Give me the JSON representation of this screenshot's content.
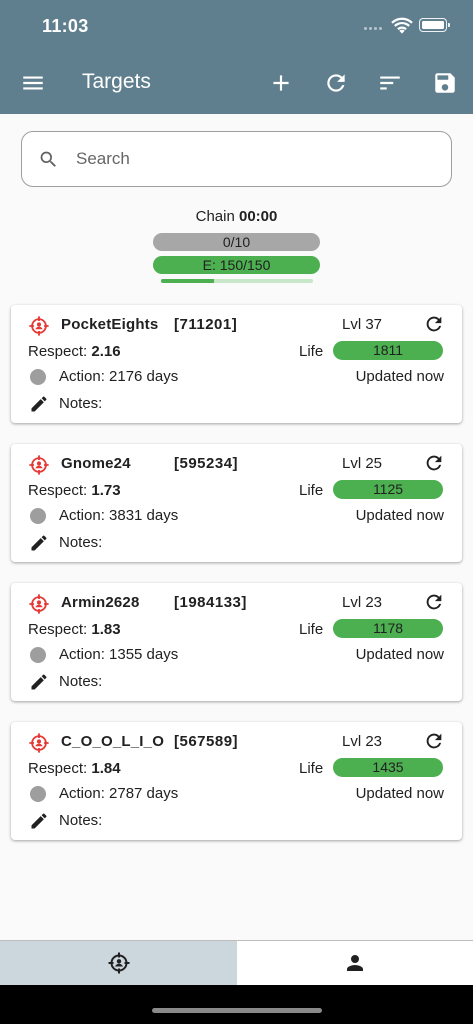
{
  "status_bar": {
    "time": "11:03"
  },
  "header": {
    "title": "Targets",
    "actions": [
      "menu-icon",
      "add-icon",
      "refresh-icon",
      "sort-icon",
      "save-icon"
    ]
  },
  "search": {
    "placeholder": "Search",
    "value": ""
  },
  "chain": {
    "label": "Chain",
    "timer": "00:00",
    "count_text": "0/10",
    "energy_text": "E: 150/150",
    "progress_fraction": 0.35
  },
  "colors": {
    "appbar": "#5f7f8e",
    "life_bar": "#4caf50",
    "target_icon": "#e53935",
    "active_tab": "#ccd6dd"
  },
  "targets": [
    {
      "name": "PocketEights",
      "id": "[711201]",
      "level": "Lvl 37",
      "respect_label": "Respect:",
      "respect": "2.16",
      "life_label": "Life",
      "life": "1811",
      "action": "Action: 2176 days",
      "updated": "Updated now",
      "notes": "Notes:"
    },
    {
      "name": "Gnome24",
      "id": "[595234]",
      "level": "Lvl 25",
      "respect_label": "Respect:",
      "respect": "1.73",
      "life_label": "Life",
      "life": "1125",
      "action": "Action: 3831 days",
      "updated": "Updated now",
      "notes": "Notes:"
    },
    {
      "name": "Armin2628",
      "id": "[1984133]",
      "level": "Lvl 23",
      "respect_label": "Respect:",
      "respect": "1.83",
      "life_label": "Life",
      "life": "1178",
      "action": "Action: 1355 days",
      "updated": "Updated now",
      "notes": "Notes:"
    },
    {
      "name": "C_O_O_L_I_O",
      "id": "[567589]",
      "level": "Lvl 23",
      "respect_label": "Respect:",
      "respect": "1.84",
      "life_label": "Life",
      "life": "1435",
      "action": "Action: 2787 days",
      "updated": "Updated now",
      "notes": "Notes:"
    }
  ],
  "bottom_nav": {
    "tabs": [
      "crosshair-icon",
      "person-icon"
    ],
    "active_index": 0
  }
}
